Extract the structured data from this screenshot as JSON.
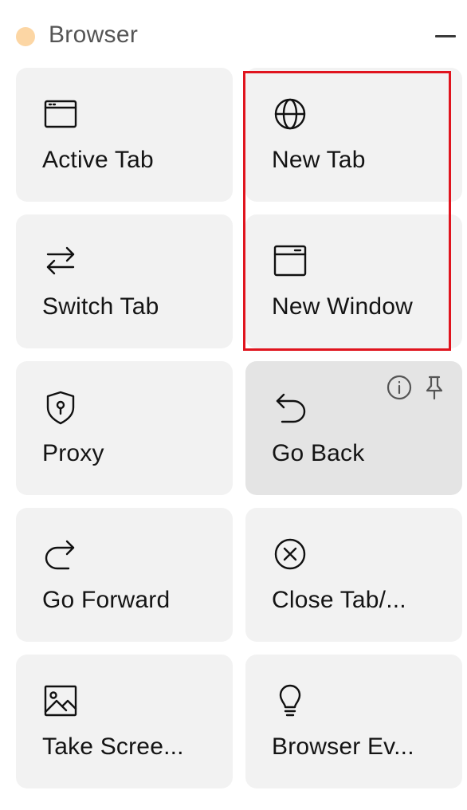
{
  "section": {
    "title": "Browser",
    "status_dot_color": "#fcd6a4",
    "collapse_icon": "minus-icon"
  },
  "cards": [
    {
      "label": "Active Tab",
      "icon": "browser-window-icon"
    },
    {
      "label": "New Tab",
      "icon": "globe-icon"
    },
    {
      "label": "Switch Tab",
      "icon": "switch-arrows-icon"
    },
    {
      "label": "New Window",
      "icon": "window-icon"
    },
    {
      "label": "Proxy",
      "icon": "shield-keyhole-icon"
    },
    {
      "label": "Go Back",
      "icon": "undo-arrow-icon",
      "hover_actions": [
        "info-icon",
        "pin-icon"
      ]
    },
    {
      "label": "Go Forward",
      "icon": "redo-arrow-icon"
    },
    {
      "label": "Close Tab/...",
      "icon": "close-circle-icon"
    },
    {
      "label": "Take Scree...",
      "icon": "image-icon"
    },
    {
      "label": "Browser Ev...",
      "icon": "lightbulb-icon"
    }
  ],
  "highlight_color": "#e0141e"
}
